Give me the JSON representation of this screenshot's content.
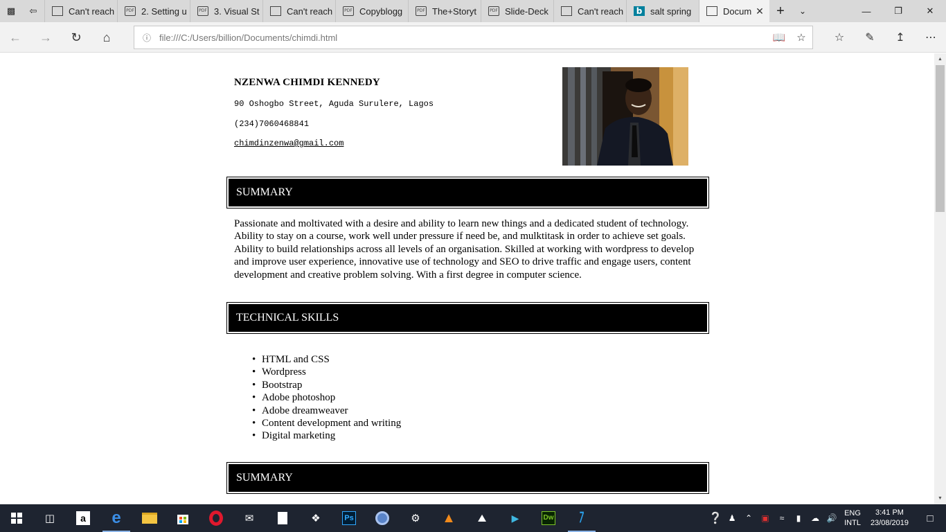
{
  "browser": {
    "tabs": [
      {
        "title": "Can't reach",
        "icon": "page-icon"
      },
      {
        "title": "2. Setting u",
        "icon": "pdf-icon"
      },
      {
        "title": "3. Visual St",
        "icon": "pdf-icon"
      },
      {
        "title": "Can't reach",
        "icon": "page-icon"
      },
      {
        "title": "Copyblogg",
        "icon": "pdf-icon"
      },
      {
        "title": "The+Storyt",
        "icon": "pdf-icon"
      },
      {
        "title": "Slide-Deck",
        "icon": "pdf-icon"
      },
      {
        "title": "Can't reach",
        "icon": "page-icon"
      },
      {
        "title": "salt spring",
        "icon": "bing-icon"
      },
      {
        "title": "Docum",
        "icon": "page-icon",
        "active": true
      }
    ],
    "pdf_icon_text": "PDF",
    "bing_icon_text": "b",
    "url": "file:///C:/Users/billion/Documents/chimdi.html"
  },
  "cv": {
    "name": "NZENWA CHIMDI KENNEDY",
    "address": "90 Oshogbo Street, Aguda Surulere, Lagos",
    "phone": "(234)7060468841",
    "email": "chimdinzenwa@gmail.com",
    "sections": {
      "summary_heading": "SUMMARY",
      "summary_text": "Passionate and moltivated with a desire and ability to learn new things and a dedicated student of technology. Ability to stay on a course, work well under pressure if need be, and mulktitask in order to achieve set goals. Ability to build relationships across all levels of an organisation. Skilled at working with wordpress to develop and improve user experience, innovative use of technology and SEO to drive traffic and engage users, content development and creative problem solving. With a first degree in computer science.",
      "skills_heading": "TECHNICAL SKILLS",
      "skills": [
        "HTML and CSS",
        "Wordpress",
        "Bootstrap",
        "Adobe photoshop",
        "Adobe dreamweaver",
        "Content development and writing",
        "Digital marketing"
      ],
      "third_heading": "SUMMARY"
    }
  },
  "taskbar": {
    "language_top": "ENG",
    "language_bottom": "INTL",
    "time": "3:41 PM",
    "date": "23/08/2019",
    "ps_label": "Ps",
    "dw_label": "Dw"
  }
}
